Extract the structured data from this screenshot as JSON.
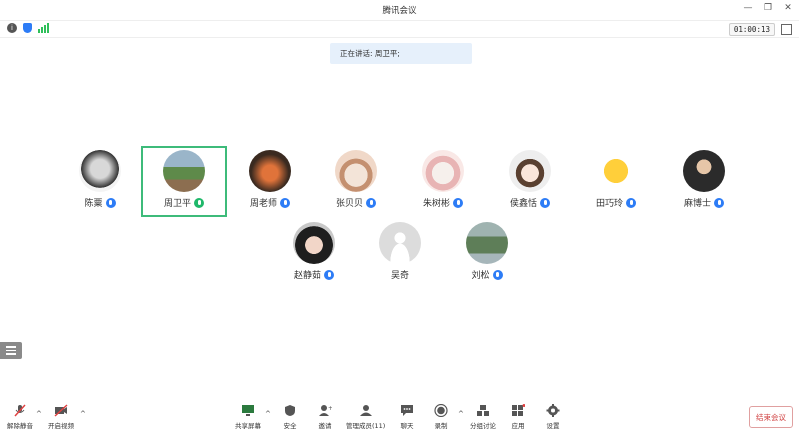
{
  "window": {
    "title": "腾讯会议",
    "controls": [
      "—",
      "❐",
      "✕"
    ]
  },
  "status": {
    "timer": "01:00:13"
  },
  "speaking": {
    "text": "正在讲话: 周卫平;"
  },
  "participants": [
    {
      "name": "陈粟",
      "mic": "blue"
    },
    {
      "name": "周卫平",
      "mic": "green"
    },
    {
      "name": "周老师",
      "mic": "blue"
    },
    {
      "name": "张贝贝",
      "mic": "blue"
    },
    {
      "name": "朱树彬",
      "mic": "blue"
    },
    {
      "name": "侯鑫恬",
      "mic": "blue"
    },
    {
      "name": "田巧玲",
      "mic": "blue"
    },
    {
      "name": "麻博士",
      "mic": "blue"
    },
    {
      "name": "赵静茹",
      "mic": "blue"
    },
    {
      "name": "吴奇",
      "mic": "none"
    },
    {
      "name": "刘松",
      "mic": "blue"
    }
  ],
  "toolbar": {
    "unmute": "解除静音",
    "video": "开启视频",
    "share": "共享屏幕",
    "security": "安全",
    "invite": "邀请",
    "members": "管理成员(11)",
    "chat": "聊天",
    "record": "录制",
    "breakout": "分组讨论",
    "apps": "应用",
    "settings": "设置",
    "end": "结束会议"
  },
  "colors": {
    "accent": "#2d7cf6",
    "speaking_border": "#3dbb7a",
    "end": "#d04040"
  }
}
